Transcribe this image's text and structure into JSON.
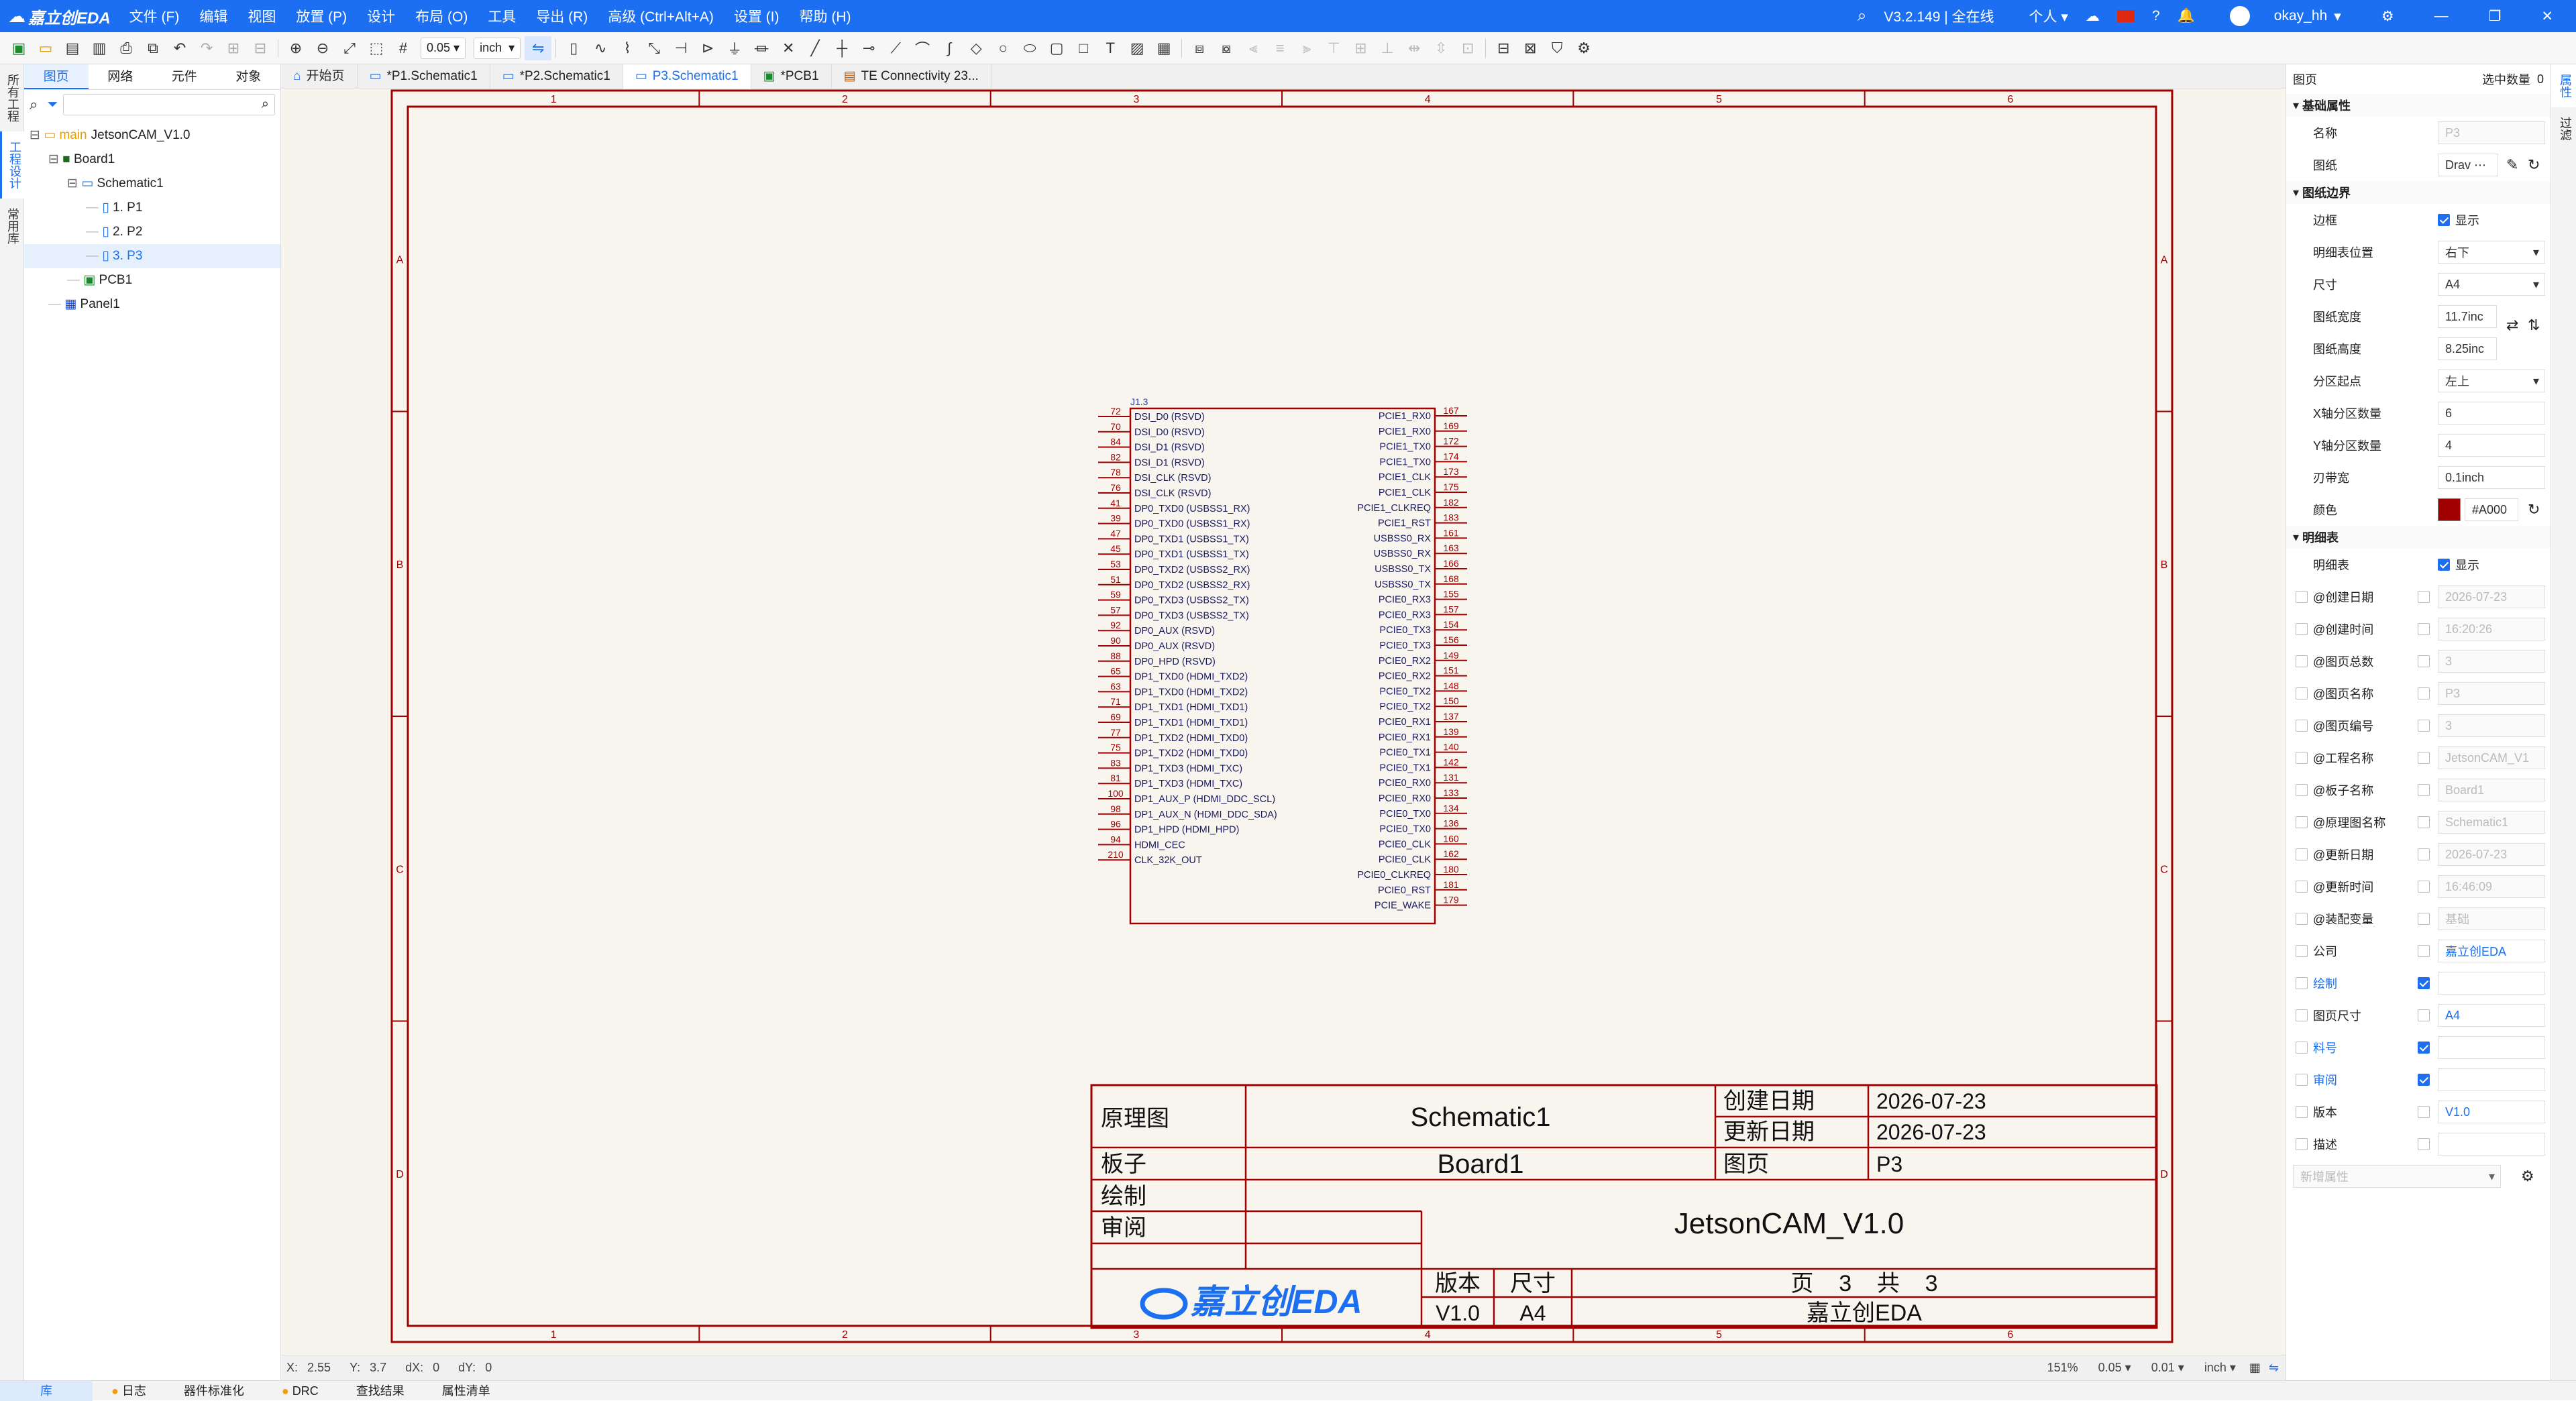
{
  "app": {
    "logo": "嘉立创EDA",
    "version": "V3.2.149 | 全在线",
    "mode": "个人",
    "user": "okay_hh",
    "brand_color": "#1d6ff2"
  },
  "menu": [
    "文件 (F)",
    "编辑",
    "视图",
    "放置 (P)",
    "设计",
    "布局 (O)",
    "工具",
    "导出 (R)",
    "高级 (Ctrl+Alt+A)",
    "设置 (I)",
    "帮助 (H)"
  ],
  "toolbar": {
    "grid": "0.05",
    "unit": "inch"
  },
  "left_strip": [
    "所有工程",
    "工程设计",
    "常用库"
  ],
  "left_panel": {
    "tabs": [
      "图页",
      "网络",
      "元件",
      "对象"
    ],
    "tree": [
      {
        "label": "main",
        "label2": "JetsonCAM_V1.0",
        "indent": 0,
        "type": "project"
      },
      {
        "label": "Board1",
        "indent": 1,
        "type": "board"
      },
      {
        "label": "Schematic1",
        "indent": 2,
        "type": "schematic"
      },
      {
        "label": "1. P1",
        "indent": 3,
        "type": "page"
      },
      {
        "label": "2. P2",
        "indent": 3,
        "type": "page"
      },
      {
        "label": "3. P3",
        "indent": 3,
        "type": "page",
        "selected": true
      },
      {
        "label": "PCB1",
        "indent": 2,
        "type": "pcb"
      },
      {
        "label": "Panel1",
        "indent": 1,
        "type": "panel"
      }
    ]
  },
  "doc_tabs": [
    "开始页",
    "*P1.Schematic1",
    "*P2.Schematic1",
    "P3.Schematic1",
    "*PCB1",
    "TE Connectivity 23..."
  ],
  "schematic": {
    "border_color": "#A00000",
    "cols": [
      "1",
      "2",
      "3",
      "4",
      "5",
      "6"
    ],
    "rows": [
      "A",
      "B",
      "C",
      "D"
    ],
    "component": {
      "ref": "J1.3",
      "left_pins": [
        {
          "num": "72",
          "name": "DSI_D0 (RSVD)"
        },
        {
          "num": "70",
          "name": "DSI_D0 (RSVD)"
        },
        {
          "num": "84",
          "name": "DSI_D1 (RSVD)"
        },
        {
          "num": "82",
          "name": "DSI_D1 (RSVD)"
        },
        {
          "num": "78",
          "name": "DSI_CLK (RSVD)"
        },
        {
          "num": "76",
          "name": "DSI_CLK (RSVD)"
        },
        {
          "num": "41",
          "name": "DP0_TXD0 (USBSS1_RX)"
        },
        {
          "num": "39",
          "name": "DP0_TXD0 (USBSS1_RX)"
        },
        {
          "num": "47",
          "name": "DP0_TXD1 (USBSS1_TX)"
        },
        {
          "num": "45",
          "name": "DP0_TXD1 (USBSS1_TX)"
        },
        {
          "num": "53",
          "name": "DP0_TXD2 (USBSS2_RX)"
        },
        {
          "num": "51",
          "name": "DP0_TXD2 (USBSS2_RX)"
        },
        {
          "num": "59",
          "name": "DP0_TXD3 (USBSS2_TX)"
        },
        {
          "num": "57",
          "name": "DP0_TXD3 (USBSS2_TX)"
        },
        {
          "num": "92",
          "name": "DP0_AUX (RSVD)"
        },
        {
          "num": "90",
          "name": "DP0_AUX (RSVD)"
        },
        {
          "num": "88",
          "name": "DP0_HPD (RSVD)"
        },
        {
          "num": "65",
          "name": "DP1_TXD0 (HDMI_TXD2)"
        },
        {
          "num": "63",
          "name": "DP1_TXD0 (HDMI_TXD2)"
        },
        {
          "num": "71",
          "name": "DP1_TXD1 (HDMI_TXD1)"
        },
        {
          "num": "69",
          "name": "DP1_TXD1 (HDMI_TXD1)"
        },
        {
          "num": "77",
          "name": "DP1_TXD2 (HDMI_TXD0)"
        },
        {
          "num": "75",
          "name": "DP1_TXD2 (HDMI_TXD0)"
        },
        {
          "num": "83",
          "name": "DP1_TXD3 (HDMI_TXC)"
        },
        {
          "num": "81",
          "name": "DP1_TXD3 (HDMI_TXC)"
        },
        {
          "num": "100",
          "name": "DP1_AUX_P (HDMI_DDC_SCL)"
        },
        {
          "num": "98",
          "name": "DP1_AUX_N (HDMI_DDC_SDA)"
        },
        {
          "num": "96",
          "name": "DP1_HPD (HDMI_HPD)"
        },
        {
          "num": "94",
          "name": "HDMI_CEC"
        },
        {
          "num": "210",
          "name": "CLK_32K_OUT"
        }
      ],
      "right_pins": [
        {
          "num": "167",
          "name": "PCIE1_RX0"
        },
        {
          "num": "169",
          "name": "PCIE1_RX0"
        },
        {
          "num": "172",
          "name": "PCIE1_TX0"
        },
        {
          "num": "174",
          "name": "PCIE1_TX0"
        },
        {
          "num": "173",
          "name": "PCIE1_CLK"
        },
        {
          "num": "175",
          "name": "PCIE1_CLK"
        },
        {
          "num": "182",
          "name": "PCIE1_CLKREQ"
        },
        {
          "num": "183",
          "name": "PCIE1_RST"
        },
        {
          "num": "161",
          "name": "USBSS0_RX"
        },
        {
          "num": "163",
          "name": "USBSS0_RX"
        },
        {
          "num": "166",
          "name": "USBSS0_TX"
        },
        {
          "num": "168",
          "name": "USBSS0_TX"
        },
        {
          "num": "155",
          "name": "PCIE0_RX3"
        },
        {
          "num": "157",
          "name": "PCIE0_RX3"
        },
        {
          "num": "154",
          "name": "PCIE0_TX3"
        },
        {
          "num": "156",
          "name": "PCIE0_TX3"
        },
        {
          "num": "149",
          "name": "PCIE0_RX2"
        },
        {
          "num": "151",
          "name": "PCIE0_RX2"
        },
        {
          "num": "148",
          "name": "PCIE0_TX2"
        },
        {
          "num": "150",
          "name": "PCIE0_TX2"
        },
        {
          "num": "137",
          "name": "PCIE0_RX1"
        },
        {
          "num": "139",
          "name": "PCIE0_RX1"
        },
        {
          "num": "140",
          "name": "PCIE0_TX1"
        },
        {
          "num": "142",
          "name": "PCIE0_TX1"
        },
        {
          "num": "131",
          "name": "PCIE0_RX0"
        },
        {
          "num": "133",
          "name": "PCIE0_RX0"
        },
        {
          "num": "134",
          "name": "PCIE0_TX0"
        },
        {
          "num": "136",
          "name": "PCIE0_TX0"
        },
        {
          "num": "160",
          "name": "PCIE0_CLK"
        },
        {
          "num": "162",
          "name": "PCIE0_CLK"
        },
        {
          "num": "180",
          "name": "PCIE0_CLKREQ"
        },
        {
          "num": "181",
          "name": "PCIE0_RST"
        },
        {
          "num": "179",
          "name": "PCIE_WAKE"
        }
      ]
    },
    "title_block": {
      "schematic_label": "原理图",
      "schematic_value": "Schematic1",
      "board_label": "板子",
      "board_value": "Board1",
      "created_label": "创建日期",
      "created_value": "2026-07-23",
      "updated_label": "更新日期",
      "updated_value": "2026-07-23",
      "page_label": "图页",
      "page_value": "P3",
      "drawn_label": "绘制",
      "review_label": "审阅",
      "project_value": "JetsonCAM_V1.0",
      "version_label": "版本",
      "size_label": "尺寸",
      "page_count_text": "页    3    共    3",
      "version_value": "V1.0",
      "size_value": "A4",
      "company_value": "嘉立创EDA",
      "logo_text": "嘉立创EDA"
    }
  },
  "statusbar": {
    "x_label": "X:",
    "x": "2.55",
    "y_label": "Y:",
    "y": "3.7",
    "dx_label": "dX:",
    "dx": "0",
    "dy_label": "dY:",
    "dy": "0",
    "zoom": "151%",
    "grid": "0.05",
    "snap": "0.01",
    "unit": "inch"
  },
  "bottom_tabs": [
    "库",
    "日志",
    "器件标准化",
    "DRC",
    "查找结果",
    "属性清单"
  ],
  "right_panel": {
    "header": "图页",
    "selected_count_label": "选中数量",
    "selected_count": "0",
    "sec_basic": "基础属性",
    "name_label": "名称",
    "name_value": "P3",
    "sheet_label": "图纸",
    "sheet_value": "Drav",
    "sec_border": "图纸边界",
    "border_label": "边框",
    "border_show": "显示",
    "tb_pos_label": "明细表位置",
    "tb_pos_value": "右下",
    "size_label": "尺寸",
    "size_value": "A4",
    "width_label": "图纸宽度",
    "width_value": "11.7inc",
    "height_label": "图纸高度",
    "height_value": "8.25inc",
    "origin_label": "分区起点",
    "origin_value": "左上",
    "xzones_label": "X轴分区数量",
    "xzones_value": "6",
    "yzones_label": "Y轴分区数量",
    "yzones_value": "4",
    "edge_label": "刃带宽",
    "edge_value": "0.1inch",
    "color_label": "颜色",
    "color_value": "#A000",
    "sec_tb": "明细表",
    "tb_label": "明细表",
    "tb_show": "显示",
    "props": [
      {
        "label": "@创建日期",
        "value": "2026-07-23",
        "checked": false,
        "disabled": true
      },
      {
        "label": "@创建时间",
        "value": "16:20:26",
        "checked": false,
        "disabled": true
      },
      {
        "label": "@图页总数",
        "value": "3",
        "checked": false,
        "disabled": true
      },
      {
        "label": "@图页名称",
        "value": "P3",
        "checked": false,
        "disabled": true
      },
      {
        "label": "@图页编号",
        "value": "3",
        "checked": false,
        "disabled": true
      },
      {
        "label": "@工程名称",
        "value": "JetsonCAM_V1",
        "checked": false,
        "disabled": true
      },
      {
        "label": "@板子名称",
        "value": "Board1",
        "checked": false,
        "disabled": true
      },
      {
        "label": "@原理图名称",
        "value": "Schematic1",
        "checked": false,
        "disabled": true
      },
      {
        "label": "@更新日期",
        "value": "2026-07-23",
        "checked": false,
        "disabled": true
      },
      {
        "label": "@更新时间",
        "value": "16:46:09",
        "checked": false,
        "disabled": true
      },
      {
        "label": "@装配变量",
        "value": "基础",
        "checked": false,
        "disabled": true
      },
      {
        "label": "公司",
        "value": "嘉立创EDA",
        "checked": false,
        "disabled": false,
        "link": true
      },
      {
        "label": "绘制",
        "value": "",
        "checked": true,
        "disabled": false,
        "labelLink": true
      },
      {
        "label": "图页尺寸",
        "value": "A4",
        "checked": false,
        "disabled": false,
        "link": true
      },
      {
        "label": "料号",
        "value": "",
        "checked": true,
        "disabled": false,
        "labelLink": true
      },
      {
        "label": "审阅",
        "value": "",
        "checked": true,
        "disabled": false,
        "labelLink": true
      },
      {
        "label": "版本",
        "value": "V1.0",
        "checked": false,
        "disabled": false,
        "link": true
      },
      {
        "label": "描述",
        "value": "",
        "checked": false,
        "disabled": false
      }
    ],
    "new_prop_placeholder": "新增属性"
  },
  "right_strip": [
    "属性",
    "过滤"
  ]
}
